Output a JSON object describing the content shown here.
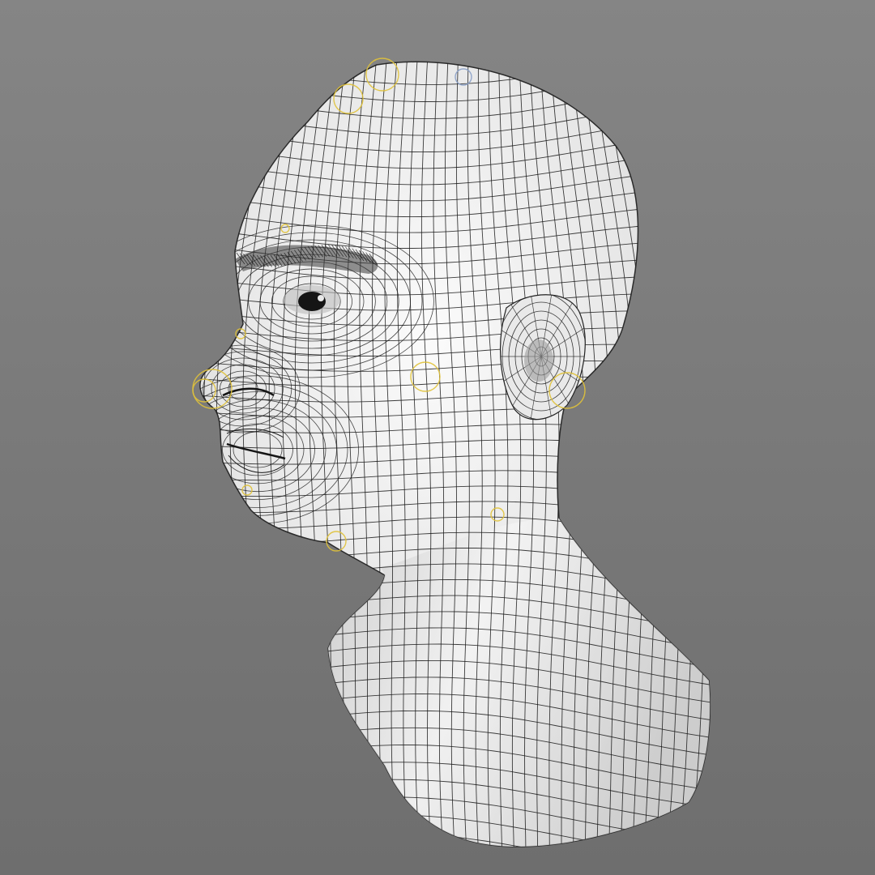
{
  "viewport": {
    "background_top": "#858585",
    "background_bottom": "#6e6e6e",
    "mesh_fill_light": "#f2f2f2",
    "mesh_fill_dark": "#a9a9a9",
    "wire_color": "#1a1a1a",
    "rig_control_color": "#e0c23a",
    "rig_control_secondary": "#8aa0c8"
  },
  "model": {
    "subject": "head-bust-wireframe",
    "shading": "smooth-shaded-with-wireframe",
    "controls_visible": true
  }
}
